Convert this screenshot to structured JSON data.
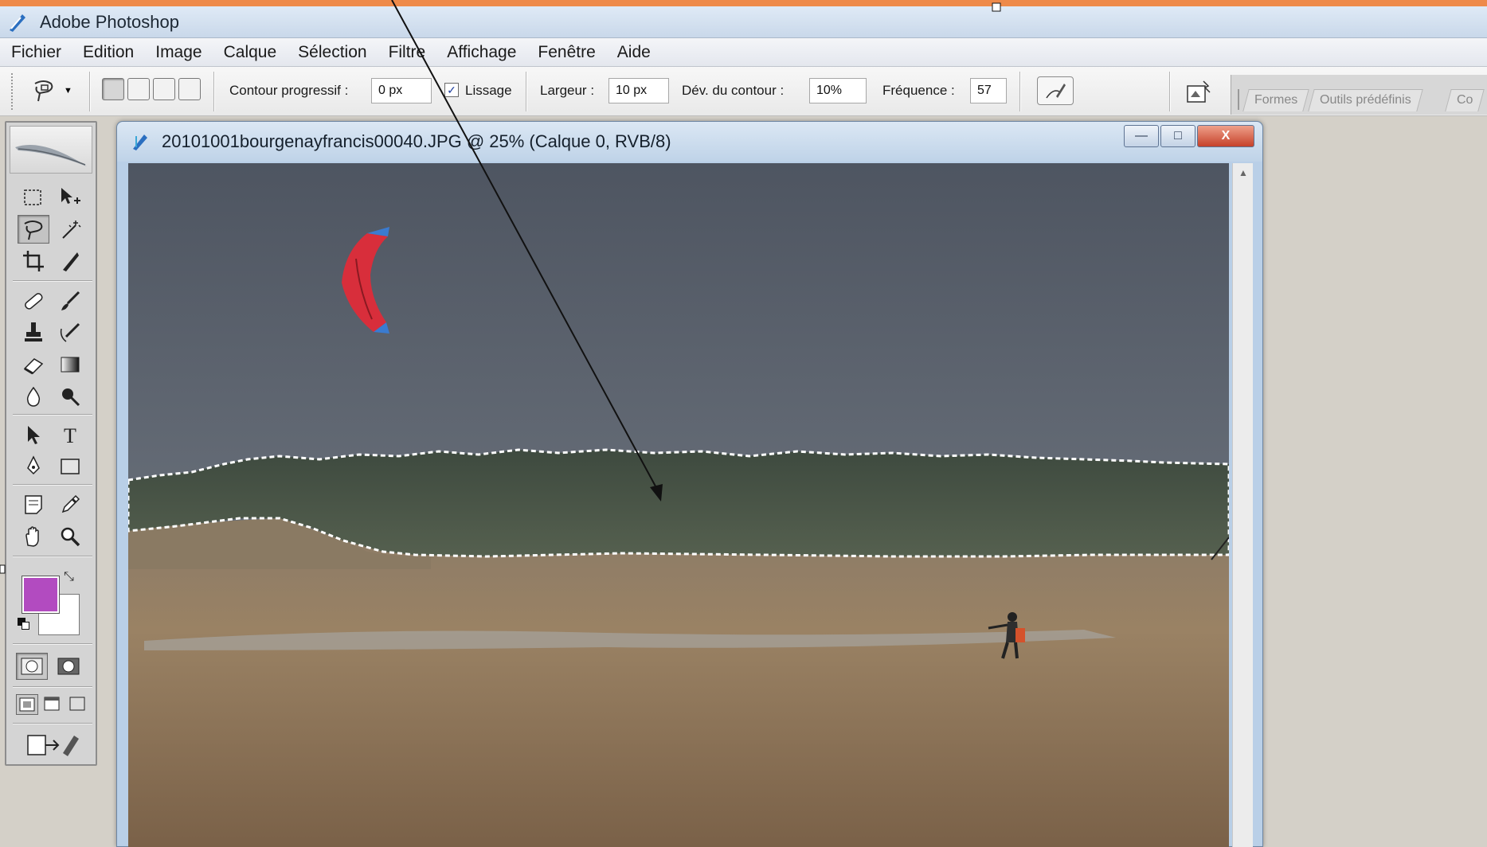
{
  "app": {
    "title": "Adobe Photoshop"
  },
  "menu": [
    "Fichier",
    "Edition",
    "Image",
    "Calque",
    "Sélection",
    "Filtre",
    "Affichage",
    "Fenêtre",
    "Aide"
  ],
  "options": {
    "feather_label": "Contour progressif :",
    "feather_value": "0 px",
    "antialias_label": "Lissage",
    "antialias_checked": true,
    "width_label": "Largeur :",
    "width_value": "10 px",
    "edge_contrast_label": "Dév. du contour :",
    "edge_contrast_value": "10%",
    "frequency_label": "Fréquence :",
    "frequency_value": "57"
  },
  "palette_well": {
    "tabs": [
      "Formes",
      "Outils prédéfinis",
      "Co"
    ]
  },
  "colors": {
    "foreground": "#b24bc0",
    "background": "#ffffff",
    "accent": "#ee8a4a"
  },
  "document": {
    "title": "20101001bourgenayfrancis00040.JPG @ 25% (Calque 0, RVB/8)",
    "zoom": "25%",
    "controls": {
      "minimize": "—",
      "maximize": "□",
      "close": "X"
    }
  },
  "icons": {
    "tools": [
      "marquee-tool-icon",
      "move-tool-icon",
      "magnetic-lasso-tool-icon",
      "magic-wand-tool-icon",
      "crop-tool-icon",
      "slice-tool-icon",
      "healing-brush-tool-icon",
      "brush-tool-icon",
      "clone-stamp-tool-icon",
      "history-brush-tool-icon",
      "eraser-tool-icon",
      "gradient-tool-icon",
      "blur-tool-icon",
      "dodge-tool-icon",
      "path-selection-tool-icon",
      "type-tool-icon",
      "pen-tool-icon",
      "shape-tool-icon",
      "notes-tool-icon",
      "eyedropper-tool-icon",
      "hand-tool-icon",
      "zoom-tool-icon"
    ]
  }
}
